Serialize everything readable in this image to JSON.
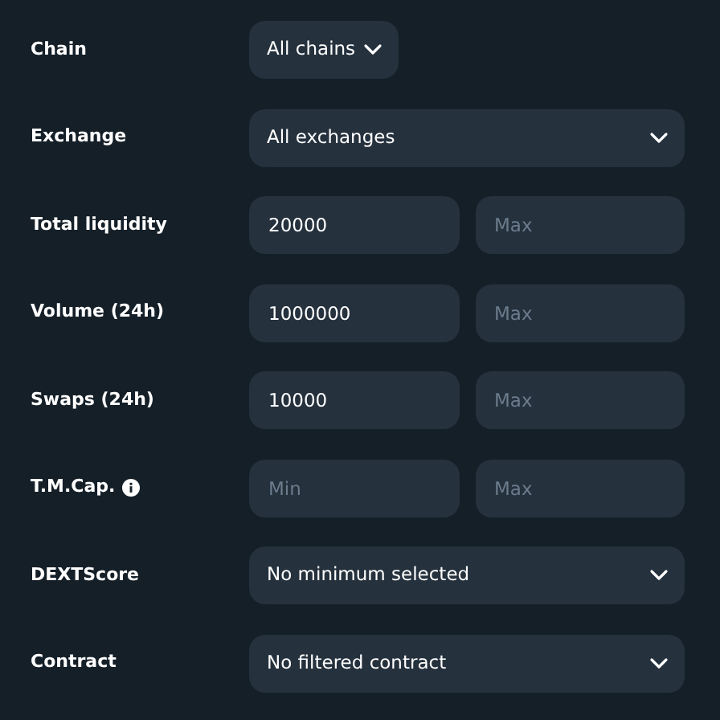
{
  "filters": [
    {
      "kind": "chip",
      "label": "Chain",
      "info": false,
      "value": "All chains"
    },
    {
      "kind": "select",
      "label": "Exchange",
      "info": false,
      "value": "All exchanges"
    },
    {
      "kind": "range",
      "label": "Total liquidity",
      "info": false,
      "min": {
        "value": "20000"
      },
      "max": {
        "placeholder": "Max"
      }
    },
    {
      "kind": "range",
      "label": "Volume (24h)",
      "info": false,
      "min": {
        "value": "1000000"
      },
      "max": {
        "placeholder": "Max"
      }
    },
    {
      "kind": "range",
      "label": "Swaps (24h)",
      "info": false,
      "min": {
        "value": "10000"
      },
      "max": {
        "placeholder": "Max"
      }
    },
    {
      "kind": "range",
      "label": "T.M.Cap.",
      "info": true,
      "min": {
        "placeholder": "Min"
      },
      "max": {
        "placeholder": "Max"
      }
    },
    {
      "kind": "select",
      "label": "DEXTScore",
      "info": false,
      "value": "No minimum selected"
    },
    {
      "kind": "select",
      "label": "Contract",
      "info": false,
      "value": "No filtered contract"
    }
  ]
}
